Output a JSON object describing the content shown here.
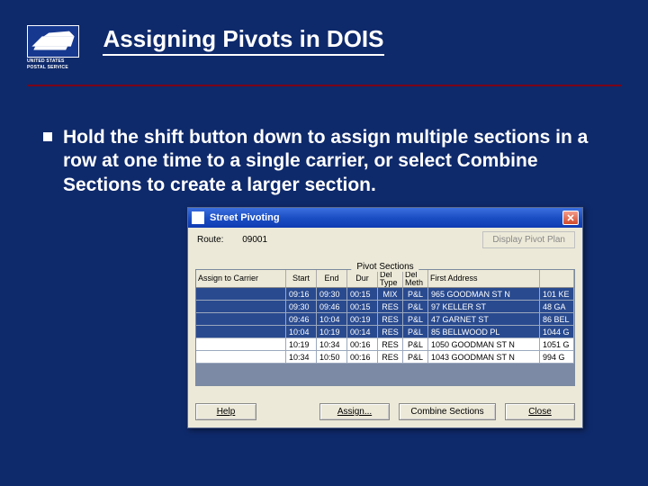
{
  "header": {
    "title": "Assigning Pivots in DOIS",
    "logo_sub1": "UNITED STATES",
    "logo_sub2": "POSTAL SERVICE"
  },
  "bullet": {
    "text": "Hold the shift button down to assign multiple sections in a row at one time to a single carrier, or select Combine Sections to create a larger section."
  },
  "window": {
    "title": "Street Pivoting",
    "route_label": "Route:",
    "route_value": "09001",
    "display_plan": "Display Pivot Plan",
    "section_label": "Pivot Sections",
    "columns": {
      "assign": "Assign to Carrier",
      "start": "Start",
      "end": "End",
      "dur": "Dur",
      "deltype": "Del Type",
      "delmeth": "Del Meth",
      "first": "First Address",
      "last": ""
    },
    "rows": [
      {
        "sel": true,
        "assign": "",
        "start": "09:16",
        "end": "09:30",
        "dur": "00:15",
        "type": "MIX",
        "meth": "P&L",
        "first": "965 GOODMAN ST N",
        "last": "101 KE"
      },
      {
        "sel": true,
        "assign": "",
        "start": "09:30",
        "end": "09:46",
        "dur": "00:15",
        "type": "RES",
        "meth": "P&L",
        "first": "97 KELLER ST",
        "last": "48 GA"
      },
      {
        "sel": true,
        "assign": "",
        "start": "09:46",
        "end": "10:04",
        "dur": "00:19",
        "type": "RES",
        "meth": "P&L",
        "first": "47 GARNET ST",
        "last": "86 BEL"
      },
      {
        "sel": true,
        "assign": "",
        "start": "10:04",
        "end": "10:19",
        "dur": "00:14",
        "type": "RES",
        "meth": "P&L",
        "first": "85 BELLWOOD PL",
        "last": "1044 G"
      },
      {
        "sel": false,
        "assign": "",
        "start": "10:19",
        "end": "10:34",
        "dur": "00:16",
        "type": "RES",
        "meth": "P&L",
        "first": "1050 GOODMAN ST N",
        "last": "1051 G"
      },
      {
        "sel": false,
        "assign": "",
        "start": "10:34",
        "end": "10:50",
        "dur": "00:16",
        "type": "RES",
        "meth": "P&L",
        "first": "1043 GOODMAN ST N",
        "last": "994 G"
      }
    ],
    "buttons": {
      "help": "Help",
      "assign": "Assign...",
      "combine": "Combine Sections",
      "close": "Close"
    }
  }
}
